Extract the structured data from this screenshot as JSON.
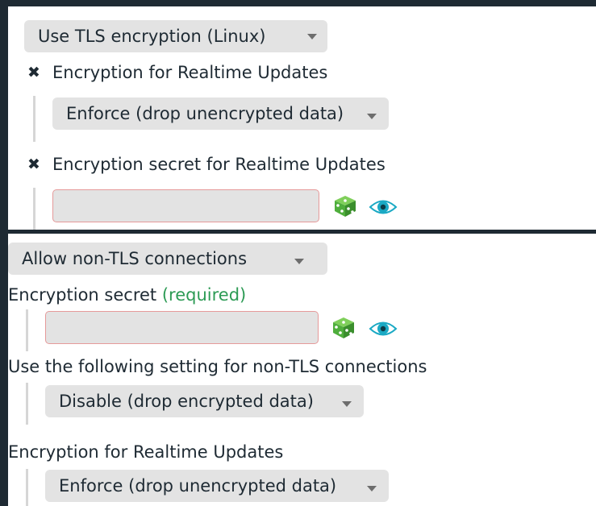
{
  "top_panel": {
    "mode_select": {
      "value": "Use TLS encryption (Linux)"
    },
    "realtime_updates": {
      "label": "Encryption for Realtime Updates",
      "select_value": "Enforce (drop unencrypted data)"
    },
    "realtime_secret": {
      "label": "Encryption secret for Realtime Updates",
      "input_value": ""
    }
  },
  "bottom_panel": {
    "mode_select": {
      "value": "Allow non-TLS connections"
    },
    "secret": {
      "label": "Encryption secret",
      "required_label": "(required)",
      "input_value": ""
    },
    "non_tls_setting": {
      "label": "Use the following setting for non-TLS connections",
      "select_value": "Disable (drop encrypted data)"
    },
    "realtime_updates": {
      "label": "Encryption for Realtime Updates",
      "select_value": "Enforce (drop unencrypted data)"
    }
  },
  "checkbox_glyph": "✖",
  "colors": {
    "background": "#1e2a33",
    "dropdown": "#e3e3e3",
    "error_border": "#e59a9a",
    "required": "#2d9b55",
    "dice": "#4fae3c",
    "eye": "#1aa9c4"
  },
  "icons": [
    "dice-icon",
    "eye-icon",
    "chevron-down-icon"
  ]
}
